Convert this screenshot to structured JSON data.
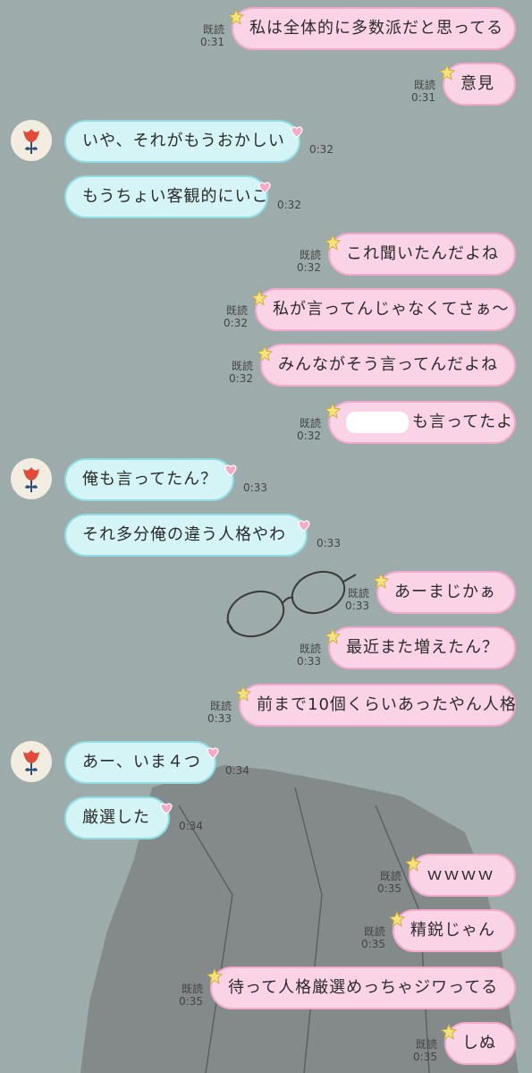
{
  "read_label": "既読",
  "colors": {
    "background": "#9dacab",
    "my_bubble": "#fbd3e6",
    "my_bubble_border": "#f3a9cb",
    "their_bubble": "#d4f4f6",
    "their_bubble_border": "#8fdde3"
  },
  "messages": [
    {
      "side": "me",
      "text": "私は全体的に多数派だと思ってる",
      "time": "0:31"
    },
    {
      "side": "me",
      "text": "意見",
      "time": "0:31"
    },
    {
      "side": "them",
      "text": "いや、それがもうおかしい",
      "time": "0:32"
    },
    {
      "side": "them",
      "text": "もうちょい客観的にいこ",
      "time": "0:32"
    },
    {
      "side": "me",
      "text": "これ聞いたんだよね",
      "time": "0:32"
    },
    {
      "side": "me",
      "text": "私が言ってんじゃなくてさぁ〜",
      "time": "0:32"
    },
    {
      "side": "me",
      "text": "みんながそう言ってんだよね",
      "time": "0:32"
    },
    {
      "side": "me",
      "text": "も言ってたよ",
      "time": "0:32",
      "redacted": true
    },
    {
      "side": "them",
      "text": "俺も言ってたん？",
      "time": "0:33"
    },
    {
      "side": "them",
      "text": "それ多分俺の違う人格やわ",
      "time": "0:33"
    },
    {
      "side": "me",
      "text": "あーまじかぁ",
      "time": "0:33"
    },
    {
      "side": "me",
      "text": "最近また増えたん？",
      "time": "0:33"
    },
    {
      "side": "me",
      "text": "前まで10個くらいあったやん人格",
      "time": "0:33"
    },
    {
      "side": "them",
      "text": "あー、いま４つ",
      "time": "0:34"
    },
    {
      "side": "them",
      "text": "厳選した",
      "time": "0:34"
    },
    {
      "side": "me",
      "text": "ｗｗｗｗ",
      "time": "0:35"
    },
    {
      "side": "me",
      "text": "精鋭じゃん",
      "time": "0:35"
    },
    {
      "side": "me",
      "text": "待って人格厳選めっちゃジワってる",
      "time": "0:35"
    },
    {
      "side": "me",
      "text": "しぬ",
      "time": "0:35"
    }
  ]
}
